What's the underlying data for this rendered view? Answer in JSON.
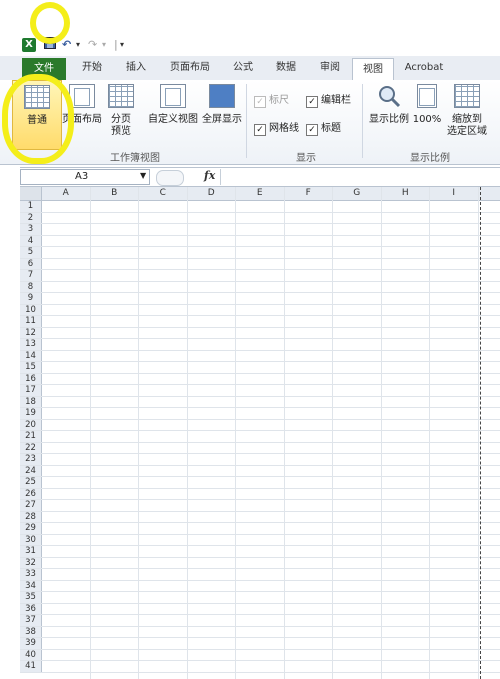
{
  "qat": {
    "app_icon": "X",
    "save_icon": "save-icon",
    "undo": "↶",
    "undo_drop": "▾",
    "redo": "↷",
    "redo_drop": "▾",
    "customize": "▾"
  },
  "tabs": [
    {
      "label": "文件"
    },
    {
      "label": "开始"
    },
    {
      "label": "插入"
    },
    {
      "label": "页面布局"
    },
    {
      "label": "公式"
    },
    {
      "label": "数据"
    },
    {
      "label": "审阅"
    },
    {
      "label": "视图"
    },
    {
      "label": "Acrobat"
    }
  ],
  "ribbon": {
    "workbook_views": {
      "normal": "普通",
      "page_layout": "页面布局",
      "page_break_1": "分页",
      "page_break_2": "预览",
      "custom_views": "自定义视图",
      "full_screen": "全屏显示",
      "group_label": "工作簿视图"
    },
    "show": {
      "ruler": "标尺",
      "formula_bar": "编辑栏",
      "gridlines": "网格线",
      "headings": "标题",
      "group_label": "显示"
    },
    "zoom": {
      "zoom": "显示比例",
      "zoom_100": "100%",
      "zoom_sel_1": "缩放到",
      "zoom_sel_2": "选定区域",
      "group_label": "显示比例"
    }
  },
  "formula_bar": {
    "name_box": "A3",
    "fx": "fx",
    "value": ""
  },
  "grid": {
    "columns": [
      "A",
      "B",
      "C",
      "D",
      "E",
      "F",
      "G",
      "H",
      "I"
    ],
    "rows": [
      "1",
      "2",
      "3",
      "4",
      "5",
      "6",
      "7",
      "8",
      "9",
      "10",
      "11",
      "12",
      "13",
      "14",
      "15",
      "16",
      "17",
      "18",
      "19",
      "20",
      "21",
      "22",
      "23",
      "24",
      "25",
      "26",
      "27",
      "28",
      "29",
      "30",
      "31",
      "32",
      "33",
      "34",
      "35",
      "36",
      "37",
      "38",
      "39",
      "40",
      "41"
    ]
  },
  "colors": {
    "file_tab": "#2b7a2b",
    "highlight": "#f4ee1a",
    "selected_button": "#ffdb6b"
  }
}
